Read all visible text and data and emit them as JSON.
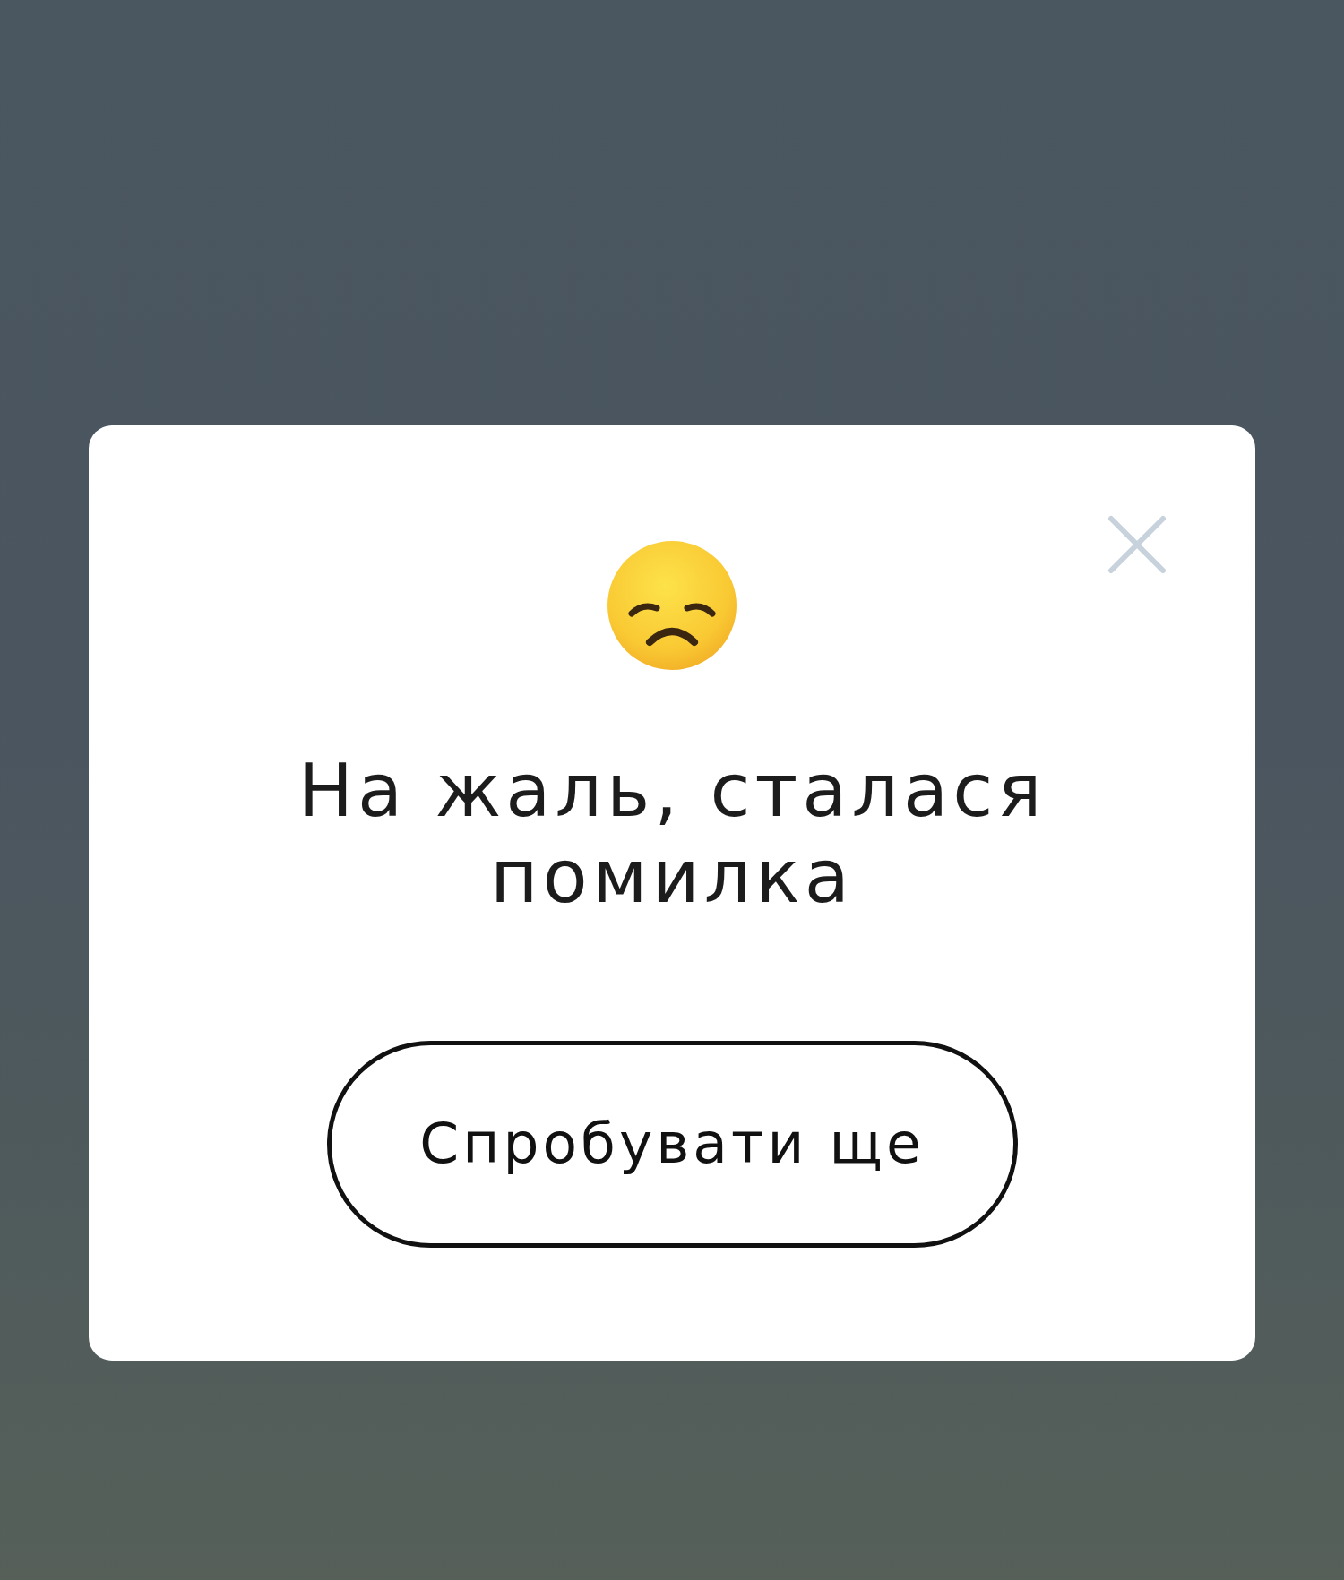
{
  "dialog": {
    "title": "На жаль, сталася помилка",
    "buttons": [
      {
        "label": "Спробувати ще"
      }
    ]
  }
}
